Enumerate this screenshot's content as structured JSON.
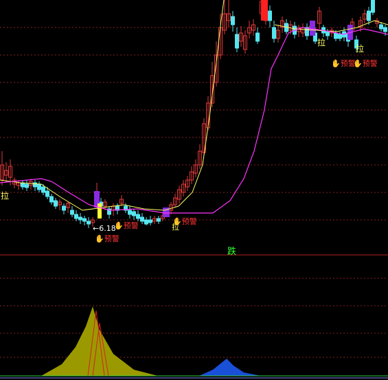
{
  "colors": {
    "background": "#000000",
    "grid": "#8a1f1f",
    "divider": "#b22222",
    "up": "#e03a3a",
    "down": "#55e6f0",
    "ma_fast": "#ffff66",
    "ma_slow": "#ff33ff",
    "signal_bar": "#8a2be2",
    "label": "#ffff66",
    "alert": "#ff3333",
    "mountain_yellow": "#9a9a00",
    "mountain_blue": "#1a4fd8",
    "spike": "#d62020",
    "baseline_green": "#2ecc40"
  },
  "annotations": {
    "pull_left": "拉",
    "pull_mid": "拉",
    "pull_right": "拉",
    "low_marker": "6.18",
    "alert_text": "预警",
    "fall_text": "跌"
  },
  "chart_data": [
    {
      "type": "candlestick",
      "title": "",
      "series": [
        {
          "name": "",
          "kind": "ma-fast"
        },
        {
          "name": "",
          "kind": "ma-slow"
        }
      ],
      "markers": [
        "拉",
        "6.18",
        "预警"
      ]
    },
    {
      "type": "area",
      "title": "",
      "series": [
        {
          "name": "",
          "kind": "mountain-yellow"
        },
        {
          "name": "",
          "kind": "mountain-blue"
        }
      ],
      "markers": [
        "跌"
      ]
    }
  ]
}
